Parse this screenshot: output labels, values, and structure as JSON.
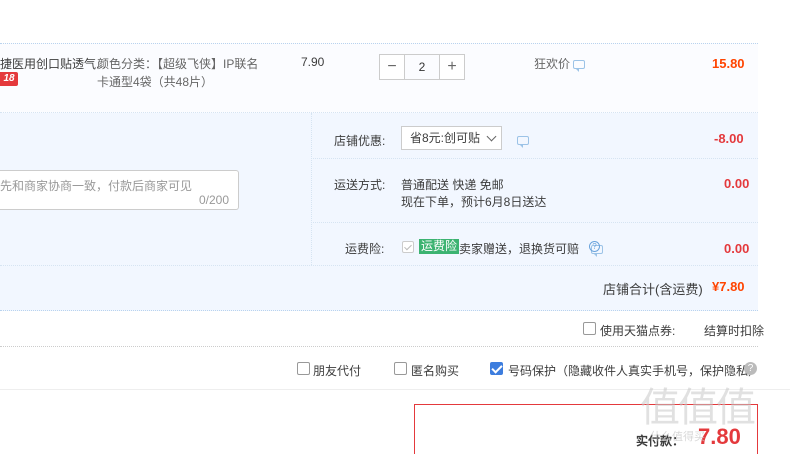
{
  "item": {
    "name": "捷医用创口贴透气...",
    "promo_tag": "18",
    "sku": "颜色分类：【超级飞侠】IP联名卡通型4袋（共48片）",
    "unit_price": "7.90",
    "qty_minus": "−",
    "qty_value": "2",
    "qty_plus": "+",
    "discount_label": "狂欢价",
    "total": "15.80"
  },
  "message": {
    "placeholder": "先和商家协商一致，付款后商家可见",
    "count": "0/200"
  },
  "shop": {
    "discount_label": "店铺优惠:",
    "coupon_selected": "省8元:创可贴",
    "discount_amount": "-8.00",
    "shipping_label": "运送方式:",
    "shipping_line1": "普通配送 快递 免邮",
    "shipping_line2": "现在下单，预计6月8日送达",
    "shipping_amount": "0.00",
    "insurance_label": "运费险:",
    "insurance_tag": "运费险",
    "insurance_desc": "卖家赠送，退换货可赔",
    "insurance_amount": "0.00",
    "total_label": "店铺合计(含运费)",
    "total_value": "¥7.80"
  },
  "coupon_row": {
    "tmall_label": "使用天猫点券:",
    "settle_label": "结算时扣除"
  },
  "options": {
    "friend_pay": "朋友代付",
    "anonymous": "匿名购买",
    "phone_protect": "号码保护（隐藏收件人真实手机号，保护隐私）",
    "help": "?"
  },
  "payment": {
    "label": "实付款：",
    "value": "7.80"
  },
  "watermark": {
    "main": "值值值",
    "sub": "什么值得买"
  },
  "colors": {
    "price_orange": "#ff4400",
    "price_red": "#e4393c",
    "section_bg": "#f2f7ff",
    "checkbox_blue": "#3d7dde"
  }
}
